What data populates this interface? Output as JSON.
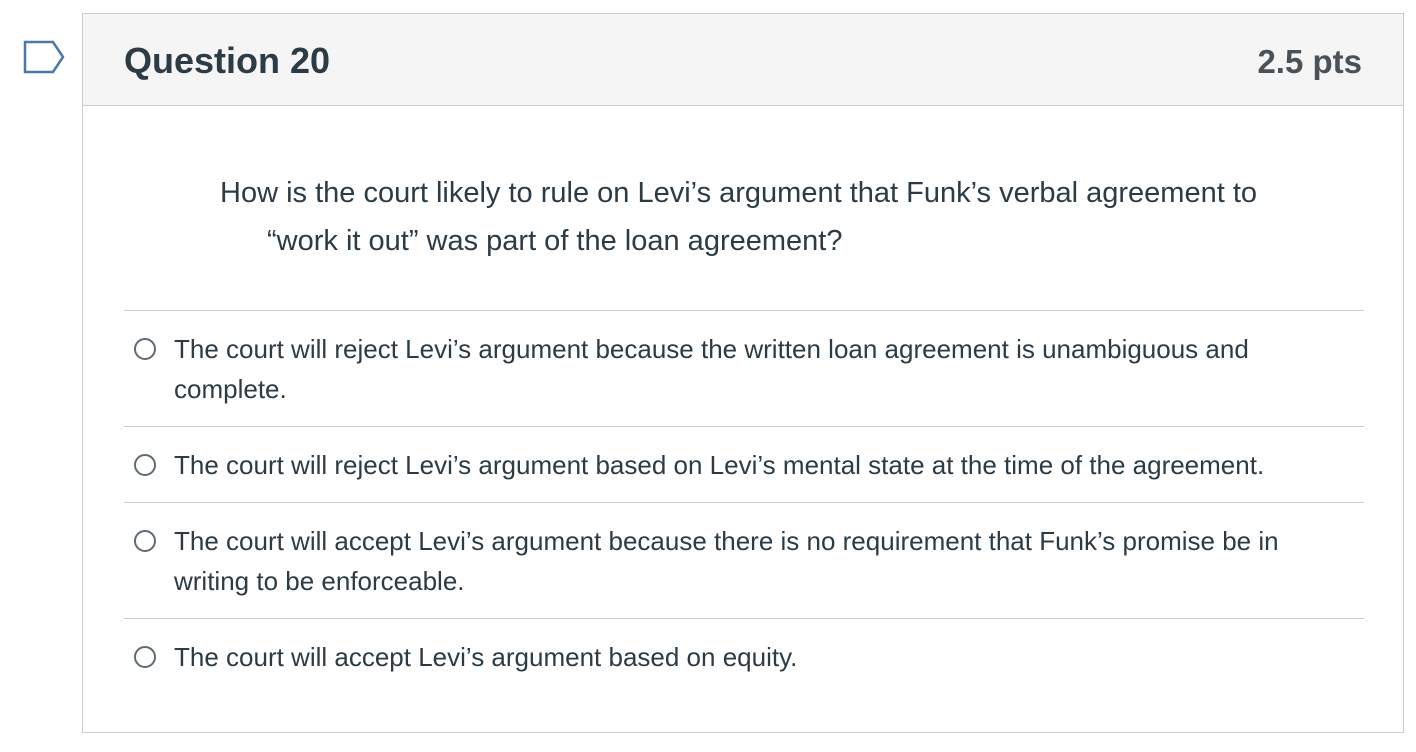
{
  "question": {
    "title": "Question 20",
    "points": "2.5 pts",
    "text_line1": "How is the court likely to rule on Levi’s argument that Funk’s verbal agreement to",
    "text_line2": "“work it out” was part of the loan agreement?"
  },
  "answers": [
    {
      "label": "The court will reject Levi’s argument because the written loan agreement is unambiguous and complete.",
      "selected": false
    },
    {
      "label": "The court will reject Levi’s argument based on Levi’s mental state at the time of the agreement.",
      "selected": false
    },
    {
      "label": "The court will accept Levi’s argument because there is no requirement that Funk’s promise be in writing to be enforceable.",
      "selected": false
    },
    {
      "label": "The court will accept Levi’s argument based on equity.",
      "selected": false
    }
  ],
  "icons": {
    "flag": "flag-question-icon"
  },
  "colors": {
    "header_bg": "#f5f5f5",
    "border": "#c7cdd1",
    "text": "#2d3b45",
    "flag": "#4a78a8"
  }
}
